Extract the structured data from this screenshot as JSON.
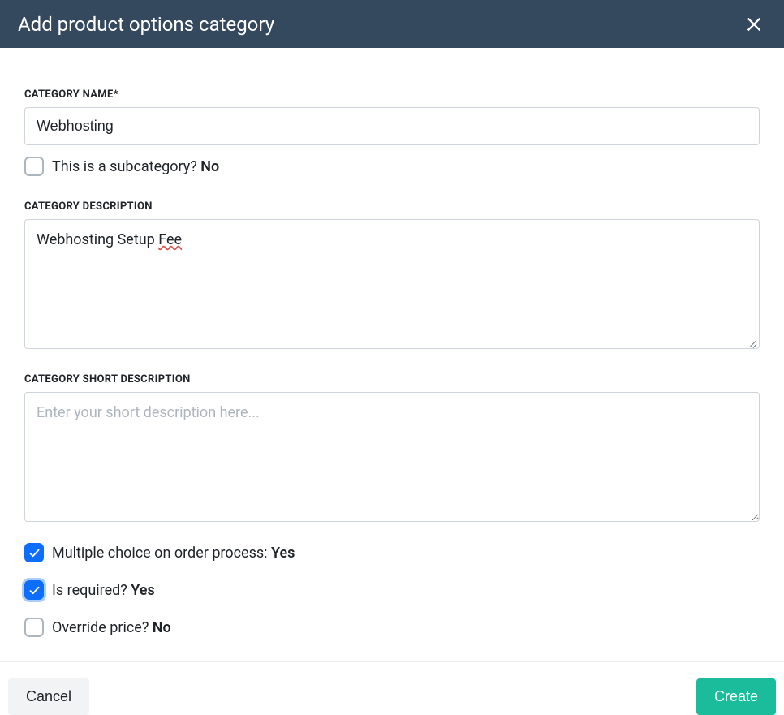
{
  "header": {
    "title": "Add product options category"
  },
  "fields": {
    "category_name": {
      "label": "CATEGORY NAME*",
      "value": "Webhosting"
    },
    "subcategory": {
      "label": "This is a subcategory? ",
      "value_text": "No",
      "checked": false
    },
    "category_description": {
      "label": "CATEGORY DESCRIPTION",
      "value_prefix": "Webhosting Setup ",
      "value_misspelled": "Fee"
    },
    "short_description": {
      "label": "CATEGORY SHORT DESCRIPTION",
      "placeholder": "Enter your short description here..."
    },
    "multiple_choice": {
      "label": "Multiple choice on order process: ",
      "value_text": "Yes",
      "checked": true
    },
    "is_required": {
      "label": "Is required? ",
      "value_text": "Yes",
      "checked": true
    },
    "override_price": {
      "label": "Override price? ",
      "value_text": "No",
      "checked": false
    }
  },
  "footer": {
    "cancel": "Cancel",
    "create": "Create"
  }
}
